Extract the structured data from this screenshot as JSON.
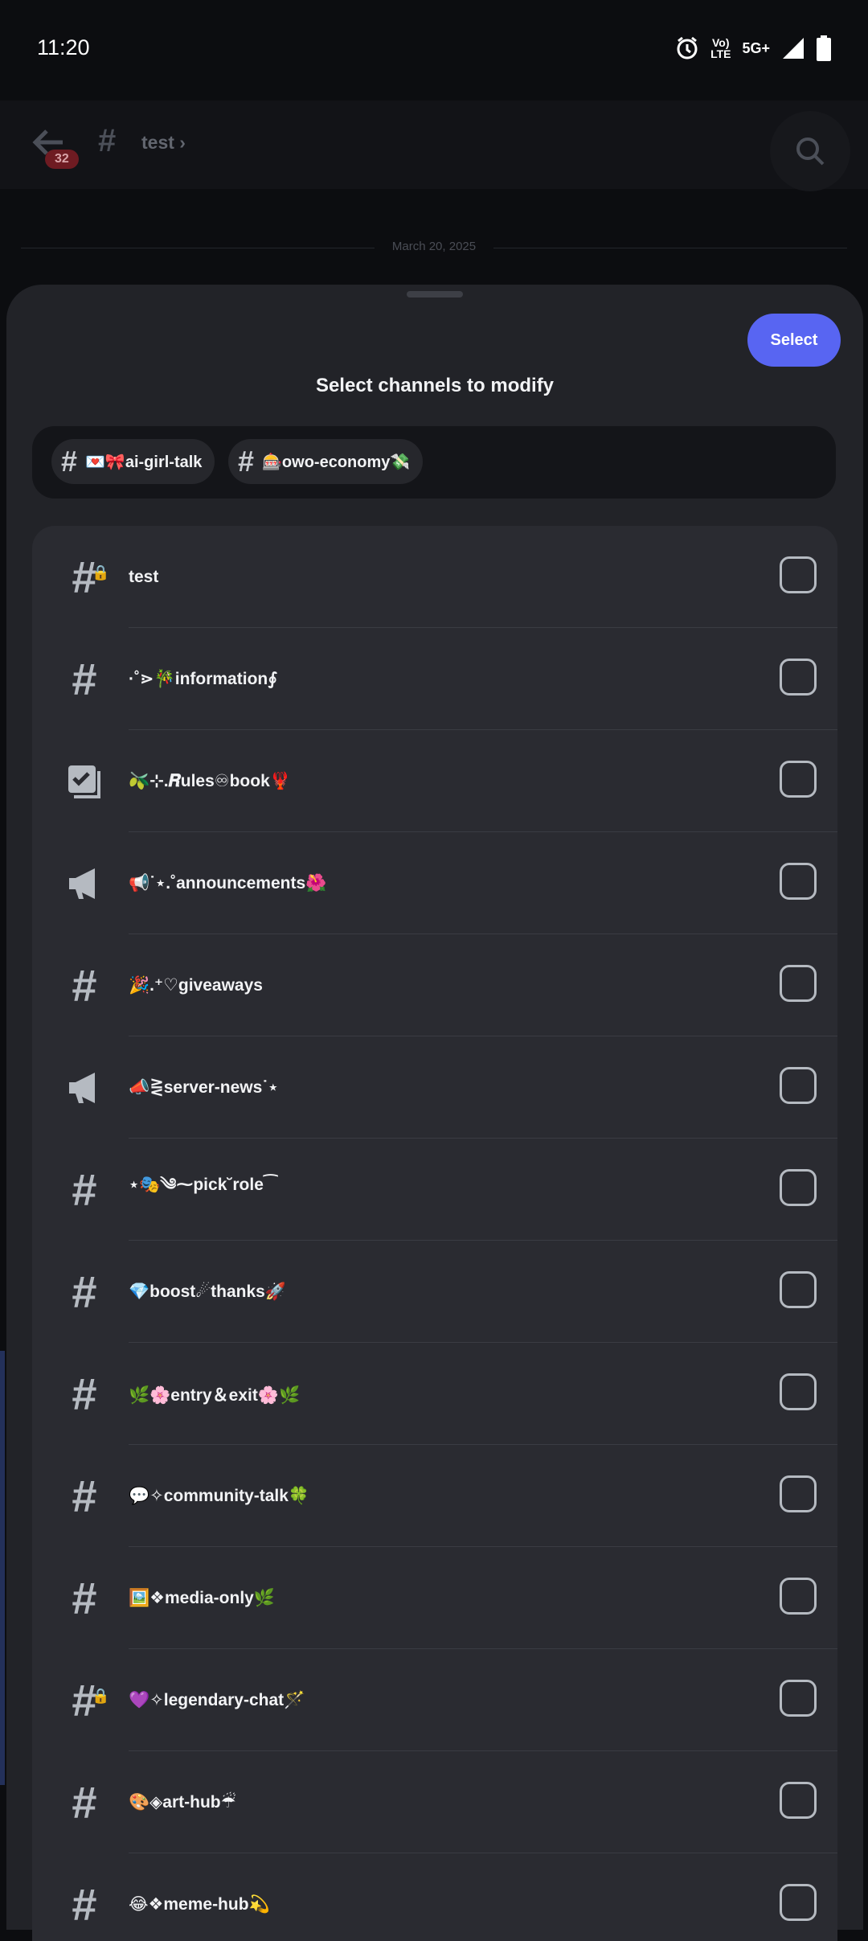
{
  "status": {
    "time": "11:20",
    "volte_top": "Vo)",
    "volte_bottom": "LTE",
    "network": "5G+"
  },
  "background": {
    "badge": "32",
    "channel_title": "test",
    "date_divider": "March 20, 2025"
  },
  "sheet": {
    "select_label": "Select",
    "title": "Select channels to modify",
    "selected_chips": [
      {
        "label": "💌🎀ai-girl-talk"
      },
      {
        "label": "🎰owo-economy💸"
      }
    ],
    "channels": [
      {
        "icon": "hash-lock-icon",
        "name": "test"
      },
      {
        "icon": "hash-icon",
        "name": "·˚⋗🎋information∮"
      },
      {
        "icon": "rules-icon",
        "name": "🫒⊹.𝑹ules♾book🦞"
      },
      {
        "icon": "announcement-icon",
        "name": "📢˙⋆.˚announcements🌺"
      },
      {
        "icon": "hash-icon",
        "name": "🎉.⁺♡giveaways"
      },
      {
        "icon": "announcement-icon",
        "name": "📣⋛server-news˙⋆"
      },
      {
        "icon": "hash-icon",
        "name": "⋆🎭༄⁓pick˘role⁀"
      },
      {
        "icon": "hash-icon",
        "name": "💎boost☄thanks🚀"
      },
      {
        "icon": "hash-icon",
        "name": "🌿🌸entry＆exit🌸🌿"
      },
      {
        "icon": "hash-icon",
        "name": "💬✧community-talk🍀"
      },
      {
        "icon": "hash-icon",
        "name": "🖼️❖media-only🌿"
      },
      {
        "icon": "hash-lock-icon",
        "name": "💜✧legendary-chat🪄"
      },
      {
        "icon": "hash-icon",
        "name": "🎨◈art-hub☔"
      },
      {
        "icon": "hash-icon",
        "name": "😂❖meme-hub💫"
      }
    ]
  }
}
